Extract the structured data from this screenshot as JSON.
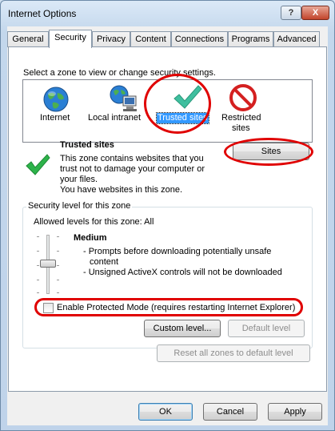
{
  "window": {
    "title": "Internet Options",
    "help_button": "?",
    "close_button": "X"
  },
  "tabs": [
    {
      "label": "General"
    },
    {
      "label": "Security",
      "active": true
    },
    {
      "label": "Privacy"
    },
    {
      "label": "Content"
    },
    {
      "label": "Connections"
    },
    {
      "label": "Programs"
    },
    {
      "label": "Advanced"
    }
  ],
  "security": {
    "instruction": "Select a zone to view or change security settings.",
    "zones": [
      {
        "label": "Internet",
        "icon": "globe-icon"
      },
      {
        "label": "Local intranet",
        "icon": "local-intranet-icon"
      },
      {
        "label": "Trusted sites",
        "icon": "checkmark-icon",
        "selected": true
      },
      {
        "label_line1": "Restricted",
        "label_line2": "sites",
        "icon": "no-entry-icon"
      }
    ],
    "zone_info": {
      "title": "Trusted sites",
      "desc_line1": "This zone contains websites that you",
      "desc_line2": "trust not to damage your computer or",
      "desc_line3": "your files.",
      "desc_line4": "You have websites in this zone."
    },
    "sites_button": "Sites",
    "level_group_title": "Security level for this zone",
    "allowed_levels": "Allowed levels for this zone: All",
    "level": {
      "name": "Medium",
      "bullet1_line1": "- Prompts before downloading potentially unsafe",
      "bullet1_line2": "content",
      "bullet2": "- Unsigned ActiveX controls will not be downloaded"
    },
    "protected_mode": {
      "label": "Enable Protected Mode (requires restarting Internet Explorer)",
      "checked": false
    },
    "custom_level_button": "Custom level...",
    "default_level_button": "Default level",
    "reset_all_button": "Reset all zones to default level"
  },
  "footer": {
    "ok": "OK",
    "cancel": "Cancel",
    "apply": "Apply"
  },
  "colors": {
    "annotation_red": "#e00000",
    "selection_blue": "#3399ff",
    "check_green": "#2db34a"
  }
}
